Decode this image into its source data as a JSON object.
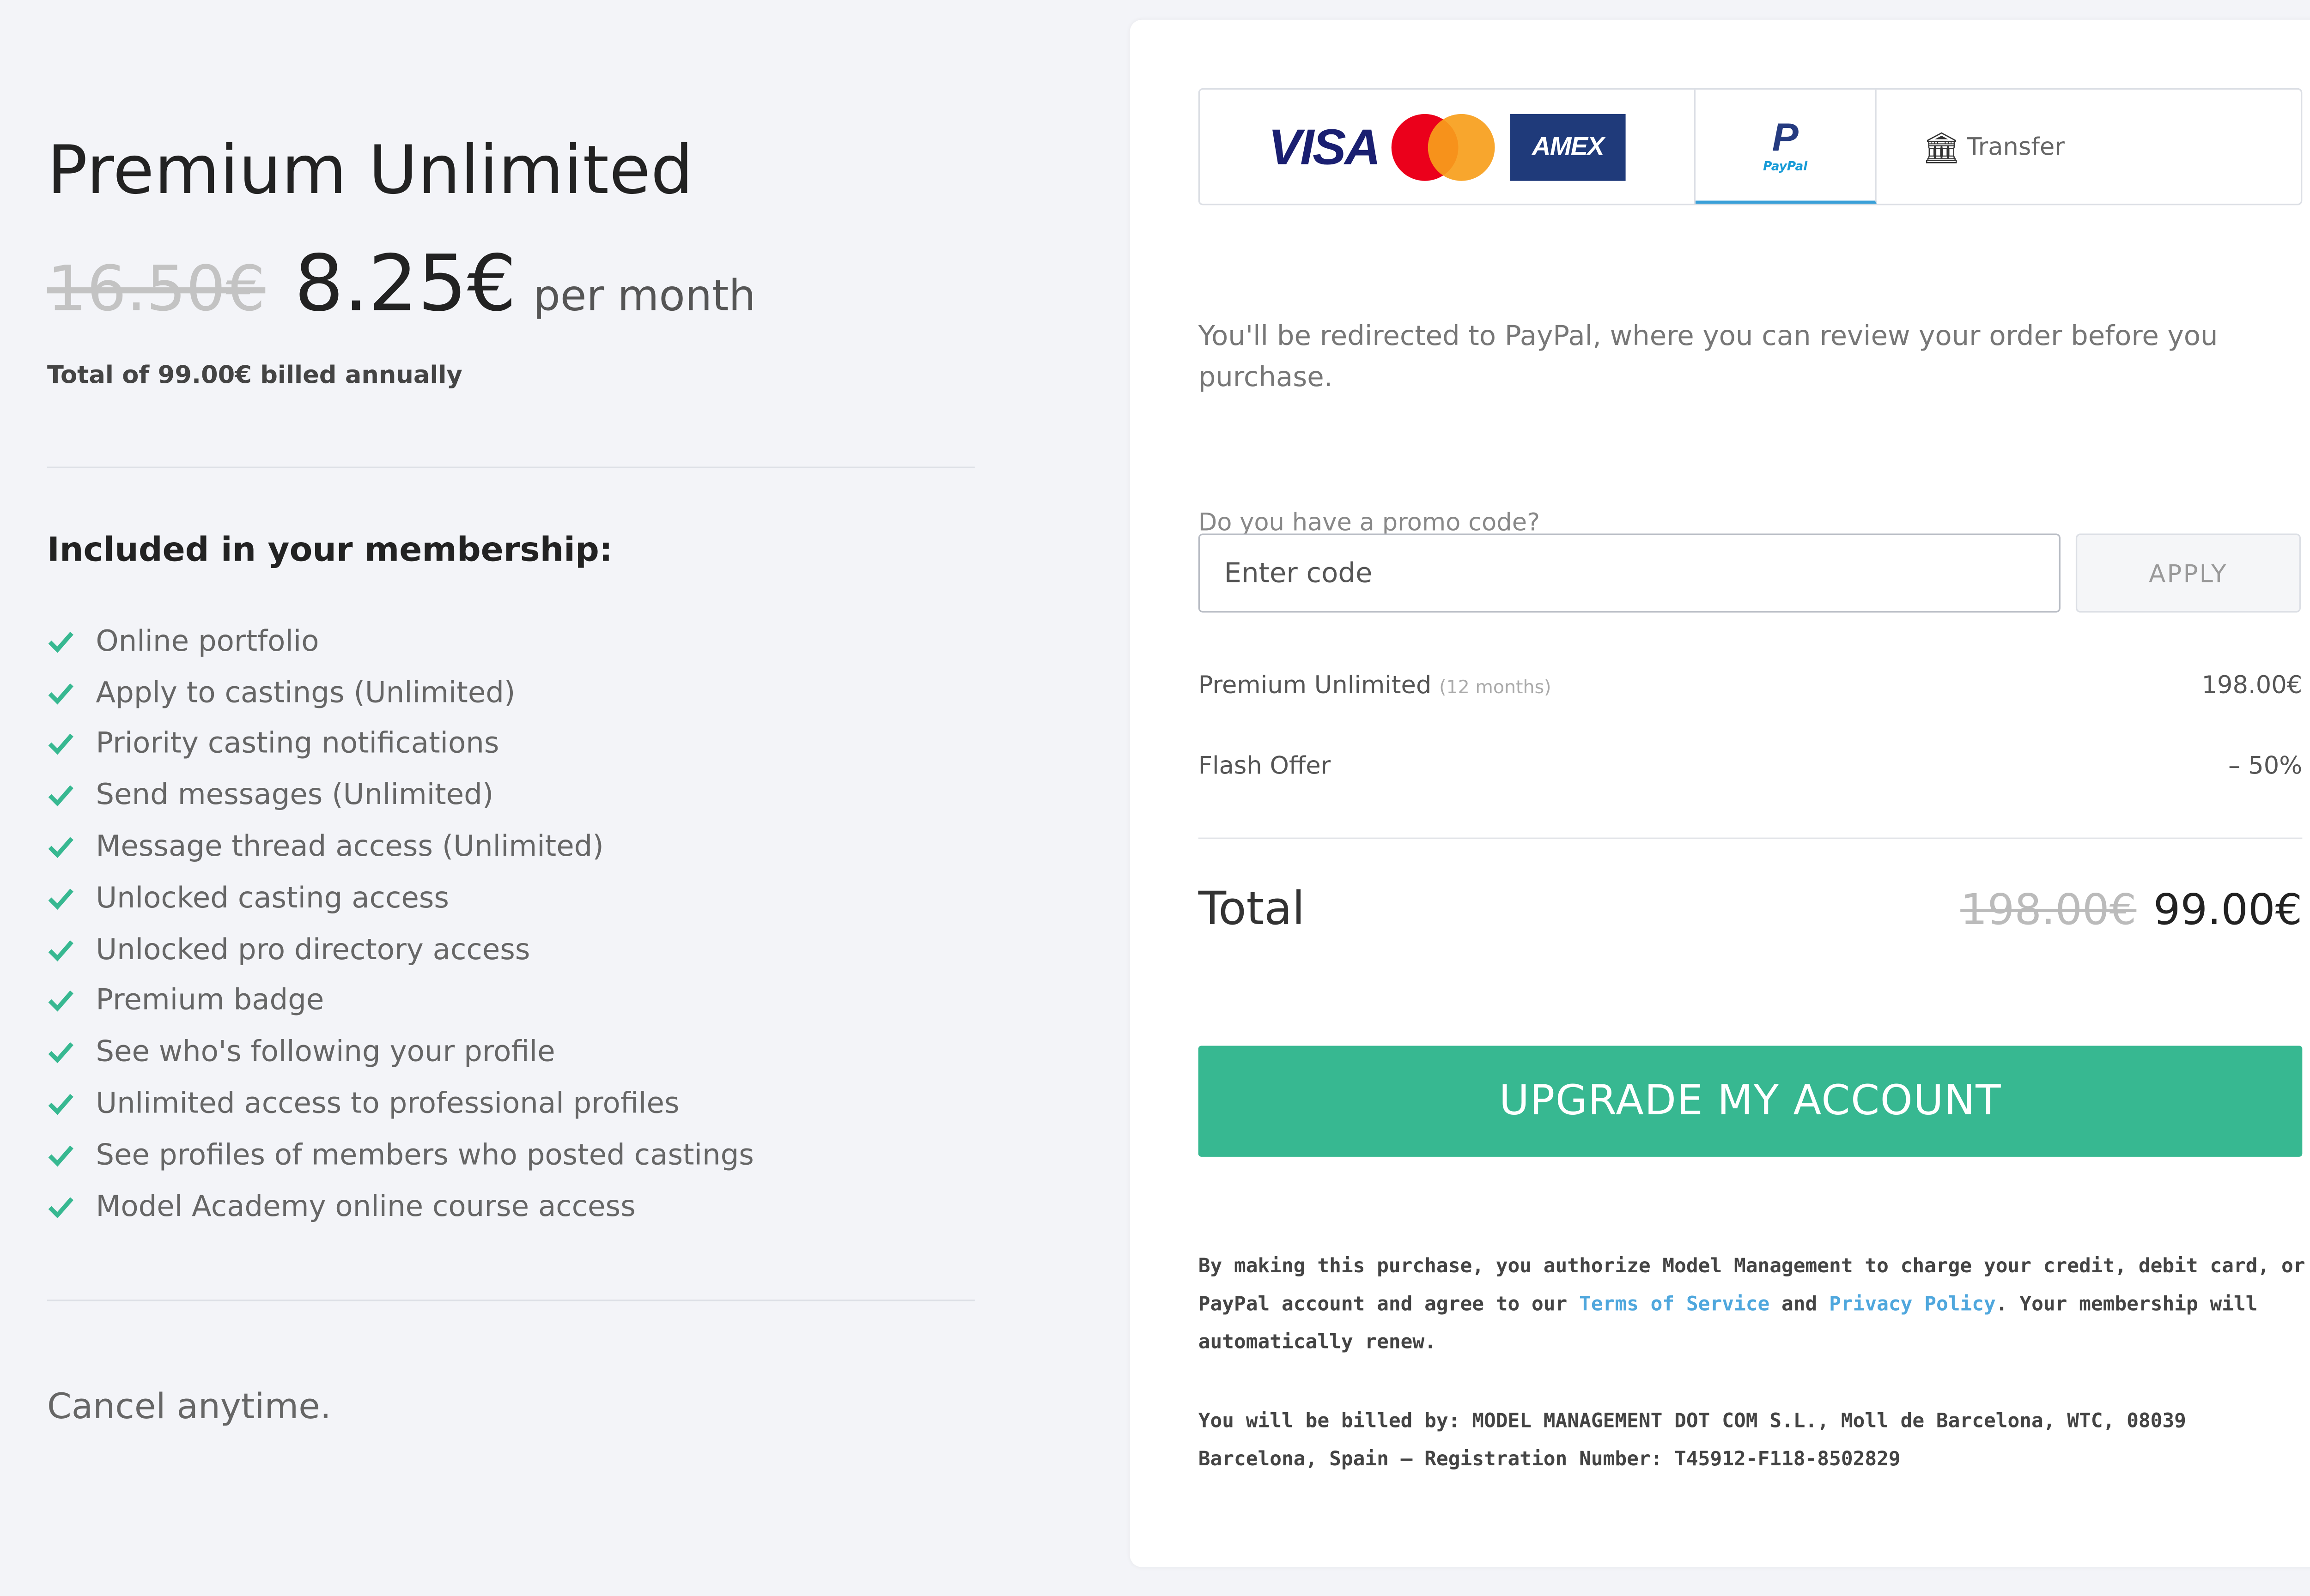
{
  "plan": {
    "title": "Premium Unlimited",
    "old_price": "16.50€",
    "new_price": "8.25€",
    "period": "per month",
    "billed_note": "Total of 99.00€ billed annually"
  },
  "membership": {
    "heading": "Included in your membership:",
    "features": [
      "Online portfolio",
      "Apply to castings (Unlimited)",
      "Priority casting notifications",
      "Send messages (Unlimited)",
      "Message thread access (Unlimited)",
      "Unlocked casting access",
      "Unlocked pro directory access",
      "Premium badge",
      "See who's following your profile",
      "Unlimited access to professional profiles",
      "See profiles of members who posted castings",
      "Model Academy online course access"
    ],
    "cancel_note": "Cancel anytime."
  },
  "payment": {
    "tabs": {
      "visa": "VISA",
      "amex": "AMEX",
      "paypal_letter": "P",
      "paypal_word": "PayPal",
      "transfer": "Transfer",
      "active": "paypal"
    },
    "redirect_text": "You'll be redirected to PayPal, where you can review your order before you purchase.",
    "promo": {
      "label": "Do you have a promo code?",
      "placeholder": "Enter code",
      "value": "",
      "apply_label": "APPLY"
    },
    "line_items": [
      {
        "label": "Premium Unlimited",
        "note": "(12 months)",
        "amount": "198.00€"
      },
      {
        "label": "Flash Offer",
        "note": "",
        "amount": "– 50%"
      }
    ],
    "total": {
      "label": "Total",
      "old": "198.00€",
      "new": "99.00€"
    },
    "upgrade_label": "UPGRADE MY ACCOUNT",
    "legal": {
      "part1": "By making this purchase, you authorize Model Management to charge your credit, debit card, or PayPal account and agree to our ",
      "terms": "Terms of Service",
      "and": " and ",
      "privacy": "Privacy Policy",
      "part2": ". Your membership will automatically renew."
    },
    "billing_text": "You will be billed by: MODEL MANAGEMENT DOT COM S.L., Moll de Barcelona, WTC, 08039 Barcelona, Spain – Registration Number: T45912-F118-8502829"
  },
  "colors": {
    "background": "#f3f4f8",
    "accent_green": "#37b891",
    "link_blue": "#4fa7dd",
    "check_green": "#37b891"
  },
  "icons": [
    "check-icon",
    "bank-icon",
    "paypal-icon",
    "mastercard-icon",
    "visa-logo",
    "amex-logo"
  ]
}
